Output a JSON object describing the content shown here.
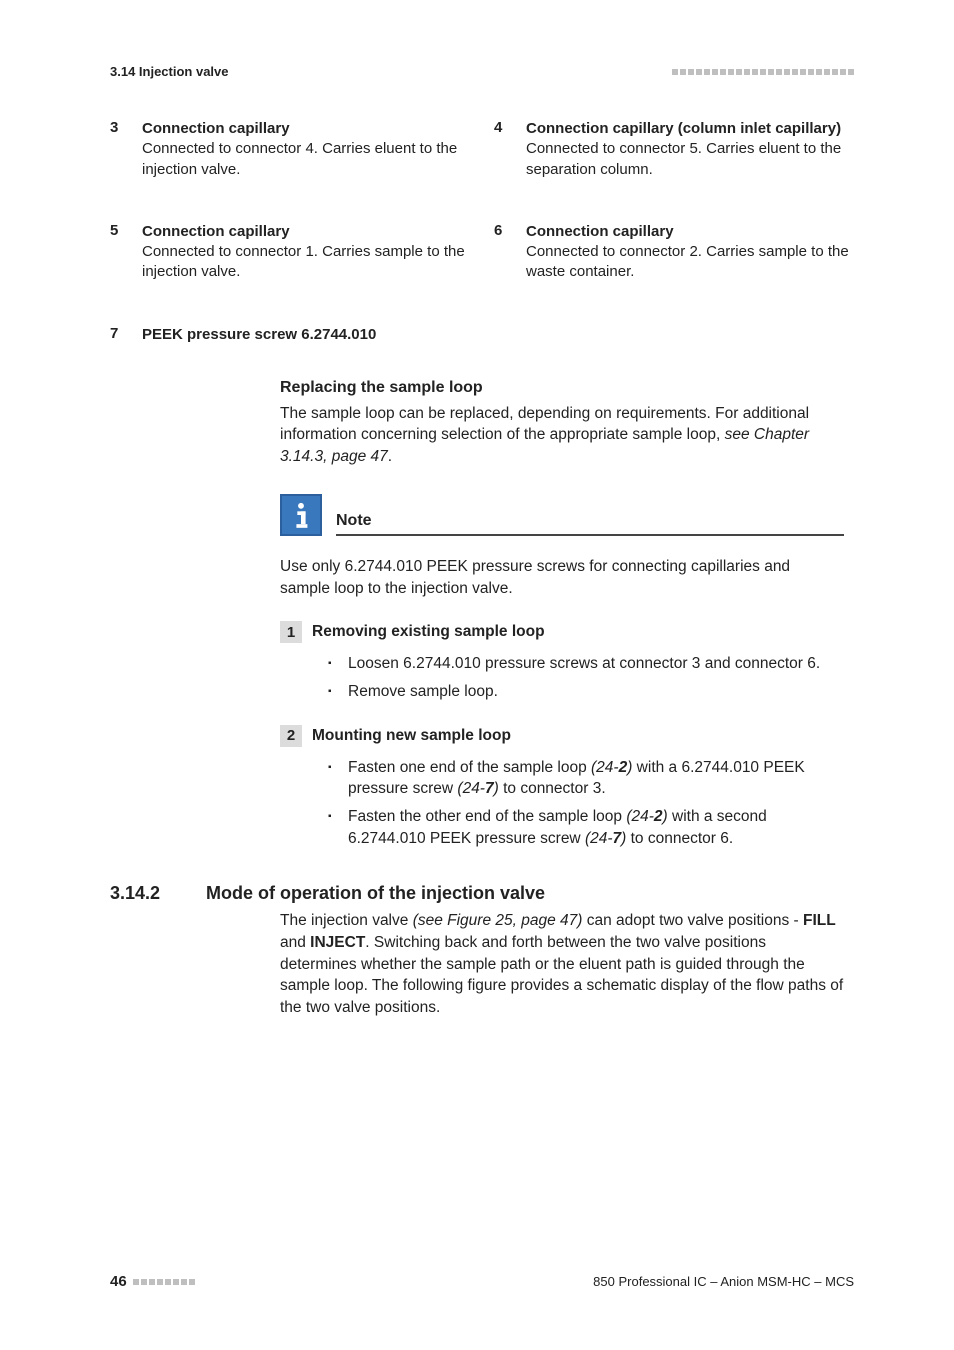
{
  "header": {
    "section": "3.14 Injection valve"
  },
  "legend": {
    "i3": {
      "num": "3",
      "title": "Connection capillary",
      "body": "Connected to connector 4. Carries eluent to the injection valve."
    },
    "i4": {
      "num": "4",
      "title": "Connection capillary (column inlet capillary)",
      "body": "Connected to connector 5. Carries eluent to the separation column."
    },
    "i5": {
      "num": "5",
      "title": "Connection capillary",
      "body": "Connected to connector 1. Carries sample to the injection valve."
    },
    "i6": {
      "num": "6",
      "title": "Connection capillary",
      "body": "Connected to connector 2. Carries sample to the waste container."
    },
    "i7": {
      "num": "7",
      "title": "PEEK pressure screw 6.2744.010"
    }
  },
  "replace": {
    "heading": "Replacing the sample loop",
    "p1": "The sample loop can be replaced, depending on requirements. For additional information concerning selection of the appropriate sample loop, ",
    "p1_ref": "see Chapter 3.14.3, page 47",
    "p1_end": "."
  },
  "note": {
    "label": "Note",
    "text": "Use only 6.2744.010 PEEK pressure screws for connecting capillaries and sample loop to the injection valve."
  },
  "steps": {
    "s1": {
      "num": "1",
      "title": "Removing existing sample loop",
      "b1": "Loosen 6.2744.010 pressure screws at connector 3 and connector 6.",
      "b2": "Remove sample loop."
    },
    "s2": {
      "num": "2",
      "title": "Mounting new sample loop",
      "b1a": "Fasten one end of the sample loop ",
      "b1b": "(24-",
      "b1c": "2",
      "b1d": ")",
      "b1e": " with a 6.2744.010 PEEK pressure screw ",
      "b1f": "(24-",
      "b1g": "7",
      "b1h": ")",
      "b1i": " to connector 3.",
      "b2a": "Fasten the other end of the sample loop ",
      "b2b": "(24-",
      "b2c": "2",
      "b2d": ")",
      "b2e": " with a second 6.2744.010 PEEK pressure screw ",
      "b2f": "(24-",
      "b2g": "7",
      "b2h": ")",
      "b2i": " to connector 6."
    }
  },
  "section": {
    "num": "3.14.2",
    "title": "Mode of operation of the injection valve",
    "p_a": "The injection valve ",
    "p_b": "(see Figure 25, page 47)",
    "p_c": " can adopt two valve positions - ",
    "p_d": "FILL",
    "p_e": " and ",
    "p_f": "INJECT",
    "p_g": ". Switching back and forth between the two valve positions determines whether the sample path or the eluent path is guided through the sample loop. The following figure provides a schematic display of the flow paths of the two valve positions."
  },
  "footer": {
    "page": "46",
    "doc": "850 Professional IC – Anion MSM-HC – MCS"
  }
}
